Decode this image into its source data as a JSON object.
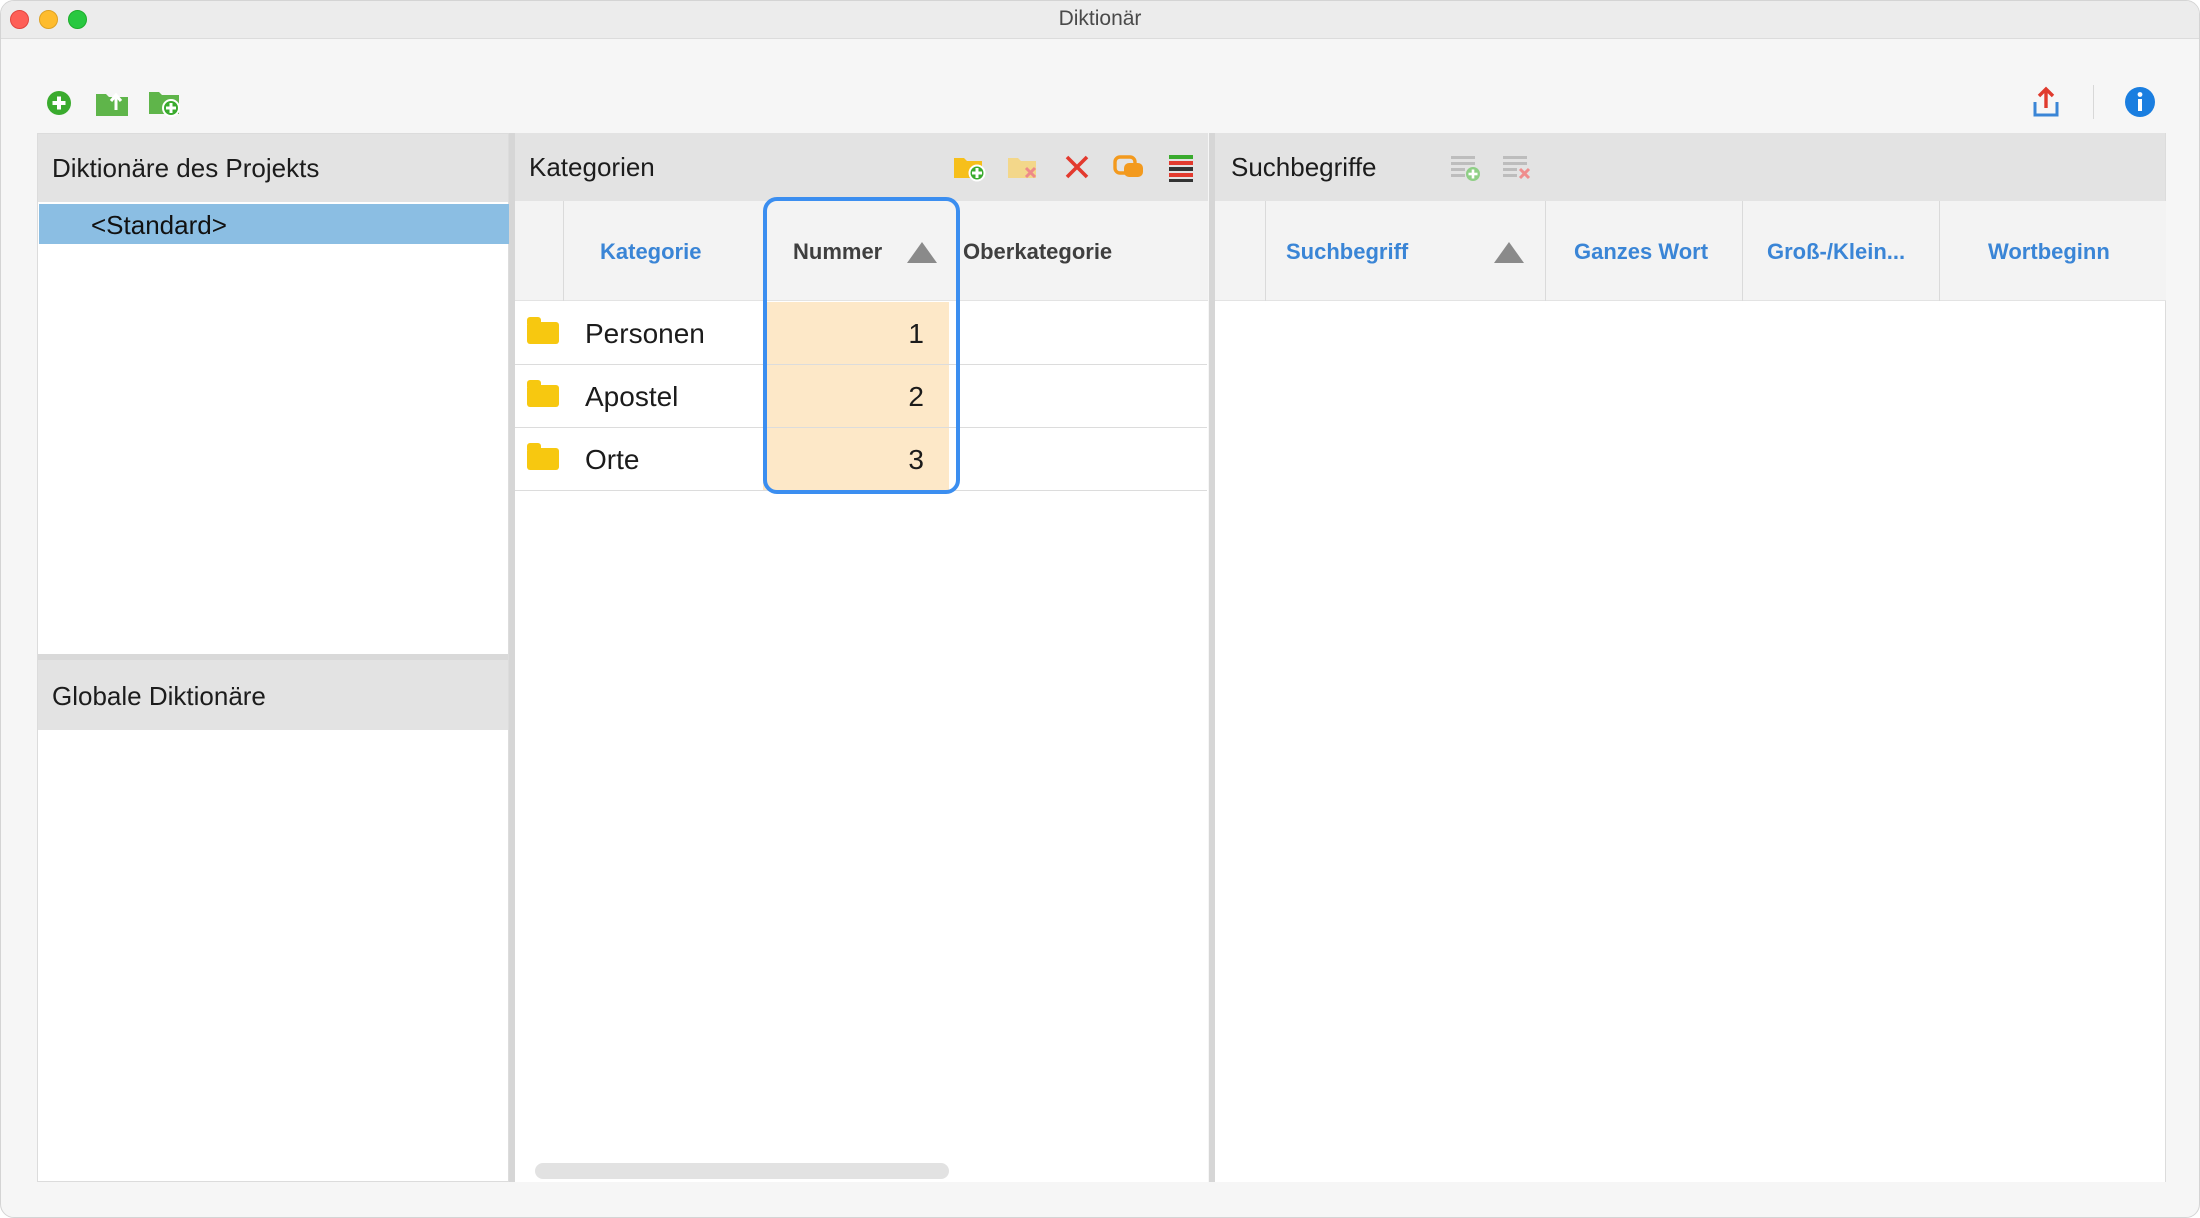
{
  "window": {
    "title": "Diktionär"
  },
  "left": {
    "project_title": "Diktionäre des Projekts",
    "items": [
      "<Standard>"
    ],
    "global_title": "Globale Diktionäre"
  },
  "categories": {
    "title": "Kategorien",
    "columns": {
      "kategorie": "Kategorie",
      "nummer": "Nummer",
      "oberkategorie": "Oberkategorie"
    },
    "sort_column": "Nummer",
    "rows": [
      {
        "name": "Personen",
        "number": "1",
        "parent": ""
      },
      {
        "name": "Apostel",
        "number": "2",
        "parent": ""
      },
      {
        "name": "Orte",
        "number": "3",
        "parent": ""
      }
    ]
  },
  "search_terms": {
    "title": "Suchbegriffe",
    "columns": {
      "suchbegriff": "Suchbegriff",
      "ganzes_wort": "Ganzes Wort",
      "gross_klein": "Groß-/Klein...",
      "wortbeginn": "Wortbeginn"
    },
    "sort_column": "Suchbegriff"
  },
  "icons": {
    "toolbar_left": [
      "add-circle-icon",
      "export-folder-icon",
      "new-folder-icon"
    ],
    "toolbar_right": [
      "share-upload-icon",
      "info-icon"
    ],
    "categories_header": [
      "add-category-icon",
      "delete-category-disabled-icon",
      "delete-x-icon",
      "merge-icon",
      "color-list-icon"
    ],
    "search_header": [
      "add-term-icon",
      "delete-term-icon"
    ]
  },
  "colors": {
    "accent": "#3a85d6",
    "selection": "#8bbee3",
    "number_highlight": "#fde8c8",
    "focus_ring": "#3b8ef0"
  }
}
